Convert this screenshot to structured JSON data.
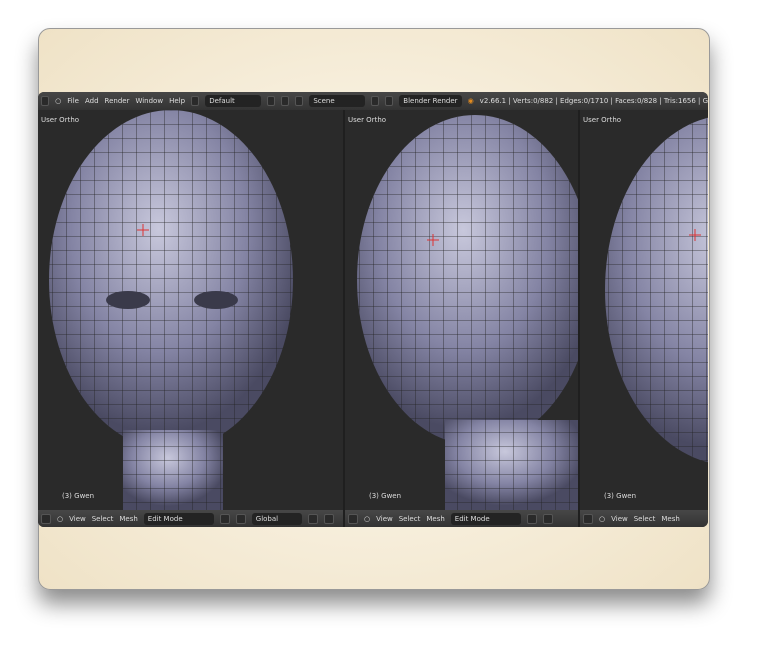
{
  "header": {
    "menus": [
      "File",
      "Add",
      "Render",
      "Window",
      "Help"
    ],
    "screen_layout": "Default",
    "scene": "Scene",
    "render_engine": "Blender Render",
    "stats": "v2.66.1 | Verts:0/882 | Edges:0/1710 | Faces:0/828 | Tris:1656 | G"
  },
  "viewports": [
    {
      "label": "User Ortho",
      "object": "(3) Gwen"
    },
    {
      "label": "User Ortho",
      "object": "(3) Gwen"
    },
    {
      "label": "User Ortho",
      "object": "(3) Gwen"
    }
  ],
  "footer": {
    "menus": [
      "View",
      "Select",
      "Mesh"
    ],
    "mode": "Edit Mode",
    "orientation": "Global"
  },
  "colors": {
    "background": "#1f1f1f",
    "header": "#3d3d3d",
    "mesh": "#8a8aa8",
    "accent": "#e08a20"
  }
}
